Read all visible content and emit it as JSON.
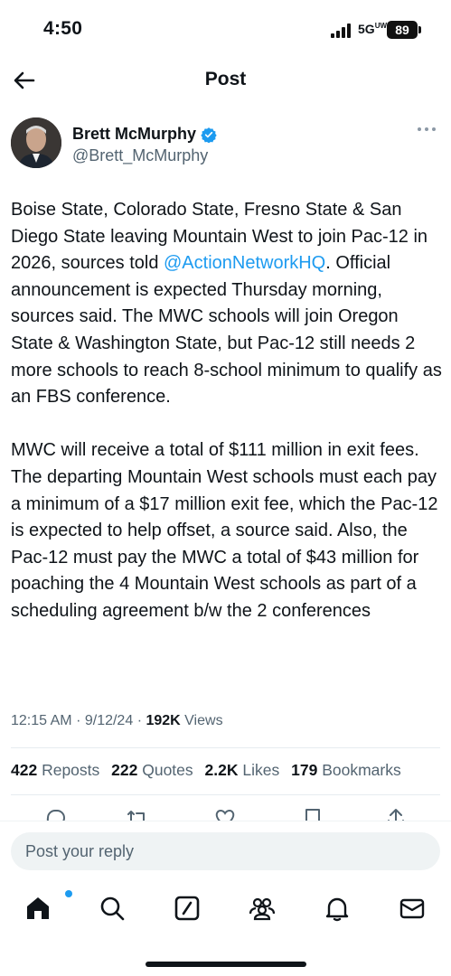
{
  "status_bar": {
    "time": "4:50",
    "network": "5G",
    "network_sup": "UW",
    "battery": "89"
  },
  "header": {
    "title": "Post"
  },
  "author": {
    "name": "Brett McMurphy",
    "handle": "@Brett_McMurphy",
    "verified": true
  },
  "tweet": {
    "p1_before": "Boise State, Colorado State, Fresno State & San Diego State leaving Mountain West to join Pac-12 in 2026, sources told ",
    "p1_mention": "@ActionNetworkHQ",
    "p1_after": ". Official announcement is expected Thursday morning, sources said. The MWC schools will join Oregon State & Washington State, but Pac-12 still needs 2 more schools to reach 8-school minimum to qualify as an FBS conference.",
    "p2": "MWC will receive a total of $111 million in exit fees. The departing Mountain West schools must each pay a minimum of a $17 million exit fee, which the Pac-12 is expected to help offset, a source said. Also, the Pac-12 must pay the MWC a total of $43 million for poaching the 4 Mountain West schools as part of a scheduling agreement b/w the 2 conferences"
  },
  "meta": {
    "time": "12:15 AM",
    "sep": "·",
    "date": "9/12/24",
    "views_count": "192K",
    "views_label": "Views"
  },
  "stats": {
    "reposts_count": "422",
    "reposts_label": "Reposts",
    "quotes_count": "222",
    "quotes_label": "Quotes",
    "likes_count": "2.2K",
    "likes_label": "Likes",
    "bookmarks_count": "179",
    "bookmarks_label": "Bookmarks"
  },
  "actions": [
    "reply-icon",
    "repost-icon",
    "like-icon",
    "bookmark-icon",
    "share-icon"
  ],
  "reply": {
    "placeholder": "Post your reply"
  },
  "tabbar": [
    "home-icon",
    "search-icon",
    "grok-icon",
    "communities-icon",
    "notifications-icon",
    "messages-icon"
  ],
  "colors": {
    "accent": "#1d9bf0",
    "text": "#0f1419",
    "secondary": "#536471"
  }
}
